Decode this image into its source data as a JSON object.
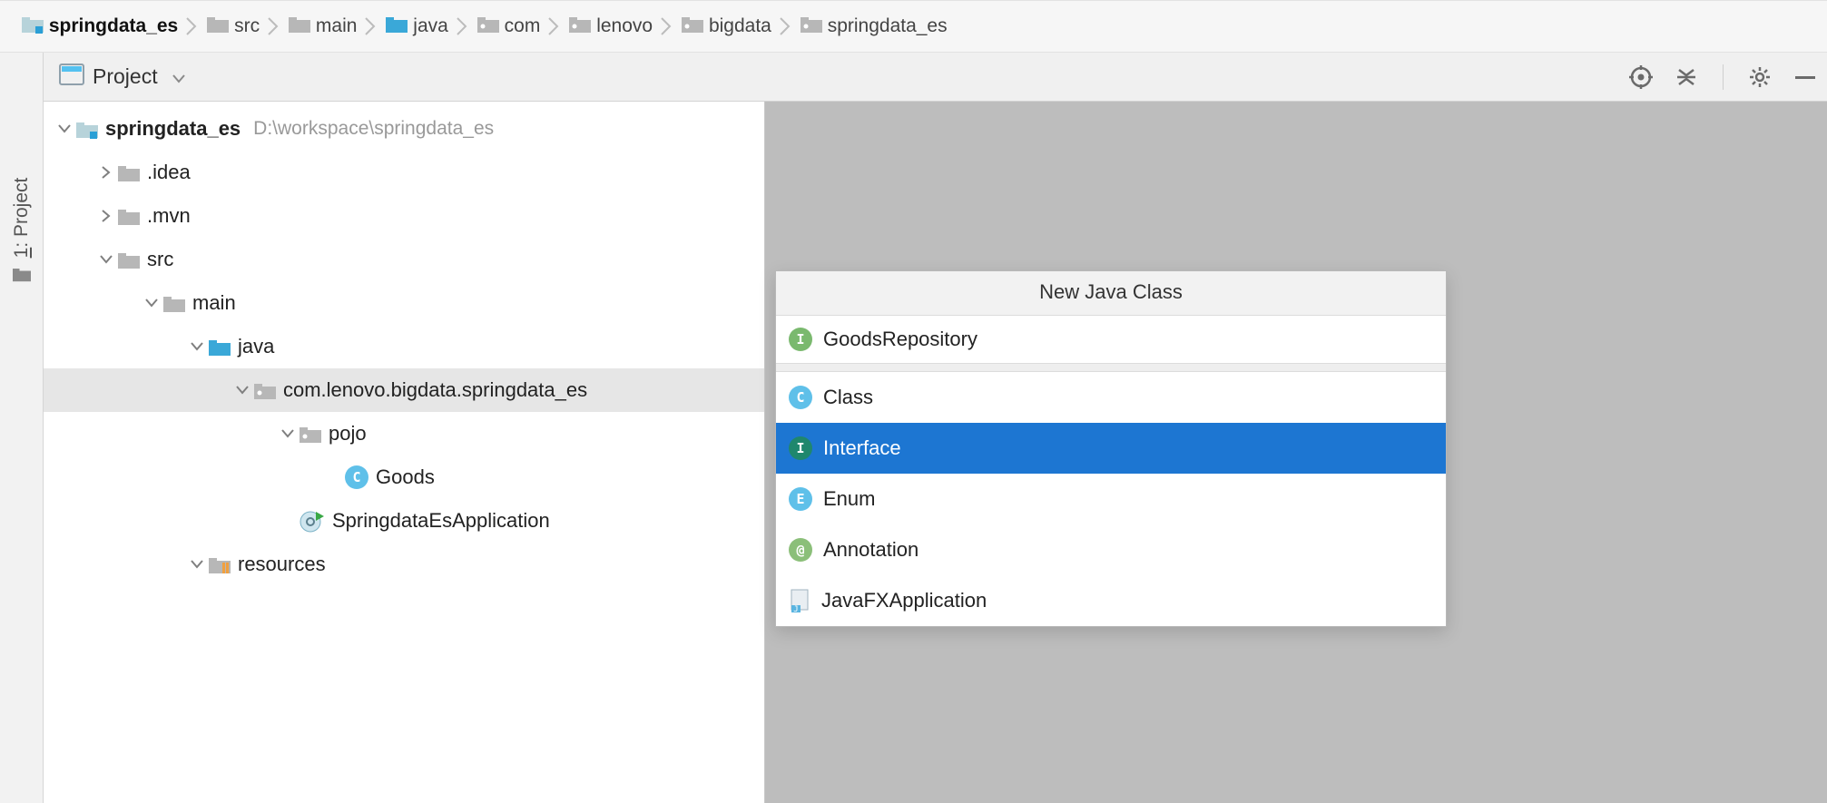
{
  "breadcrumb": [
    {
      "label": "springdata_es",
      "icon": "module",
      "bold": true
    },
    {
      "label": "src",
      "icon": "folder"
    },
    {
      "label": "main",
      "icon": "folder"
    },
    {
      "label": "java",
      "icon": "folder-src"
    },
    {
      "label": "com",
      "icon": "package"
    },
    {
      "label": "lenovo",
      "icon": "package"
    },
    {
      "label": "bigdata",
      "icon": "package"
    },
    {
      "label": "springdata_es",
      "icon": "package"
    }
  ],
  "gutter": {
    "label_prefix": "1",
    "label": ": Project"
  },
  "tool_window": {
    "title": "Project"
  },
  "tree": {
    "root": {
      "name": "springdata_es",
      "hint": "D:\\workspace\\springdata_es"
    },
    "idea": ".idea",
    "mvn": ".mvn",
    "src": "src",
    "main": "main",
    "java": "java",
    "pkg": "com.lenovo.bigdata.springdata_es",
    "pojo": "pojo",
    "goods": "Goods",
    "app": "SpringdataEsApplication",
    "resources": "resources"
  },
  "popup": {
    "title": "New Java Class",
    "input_value": "GoodsRepository",
    "items": [
      {
        "label": "Class",
        "badge": "C",
        "badge_color": "rb-blue"
      },
      {
        "label": "Interface",
        "badge": "I",
        "badge_color": "rb-teal",
        "selected": true
      },
      {
        "label": "Enum",
        "badge": "E",
        "badge_color": "rb-blue"
      },
      {
        "label": "Annotation",
        "badge": "@",
        "badge_color": "rb-green-at"
      },
      {
        "label": "JavaFXApplication",
        "badge": "J",
        "badge_color": "file"
      }
    ]
  }
}
